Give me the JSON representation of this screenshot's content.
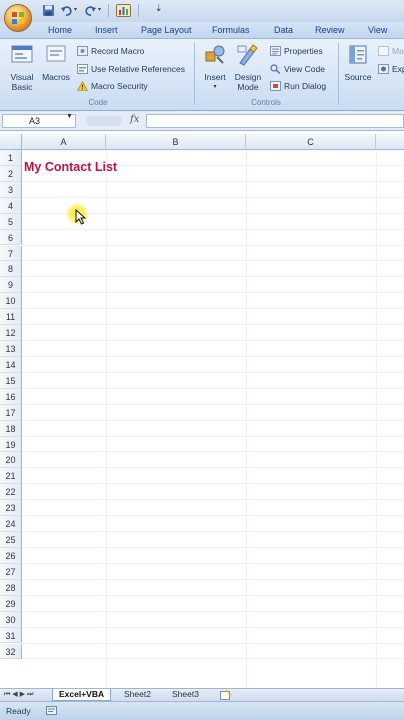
{
  "quick_access": {
    "icons": [
      "save-icon",
      "undo-icon",
      "redo-icon",
      "chart-icon",
      "customize-qat-icon"
    ]
  },
  "ribbon_tabs": [
    "Home",
    "Insert",
    "Page Layout",
    "Formulas",
    "Data",
    "Review",
    "View"
  ],
  "ribbon": {
    "code_group": {
      "label": "Code",
      "visual_basic": "Visual Basic",
      "macros": "Macros",
      "record_macro": "Record Macro",
      "use_relative_references": "Use Relative References",
      "macro_security": "Macro Security"
    },
    "controls_group": {
      "label": "Controls",
      "insert": "Insert",
      "design_mode": "Design Mode",
      "properties": "Properties",
      "view_code": "View Code",
      "run_dialog": "Run Dialog"
    },
    "xml_group": {
      "source": "Source",
      "ma": "Ma",
      "exp": "Exp"
    }
  },
  "formula_bar": {
    "name_box": "A3",
    "fx_label": "fx",
    "formula_value": ""
  },
  "grid": {
    "columns": [
      "A",
      "B",
      "C"
    ],
    "rows": [
      "1",
      "2",
      "3",
      "4",
      "5",
      "6",
      "7",
      "8",
      "9",
      "10",
      "11",
      "12",
      "13",
      "14",
      "15",
      "16",
      "17",
      "18",
      "19",
      "20",
      "21",
      "22",
      "23",
      "24",
      "25",
      "26",
      "27",
      "28",
      "29",
      "30",
      "31",
      "32"
    ],
    "a1_value": "My Contact List",
    "title_color": "#c4104a"
  },
  "sheet_tabs": [
    "Excel+VBA",
    "Sheet2",
    "Sheet3"
  ],
  "active_sheet": "Excel+VBA",
  "status": {
    "text": "Ready"
  }
}
